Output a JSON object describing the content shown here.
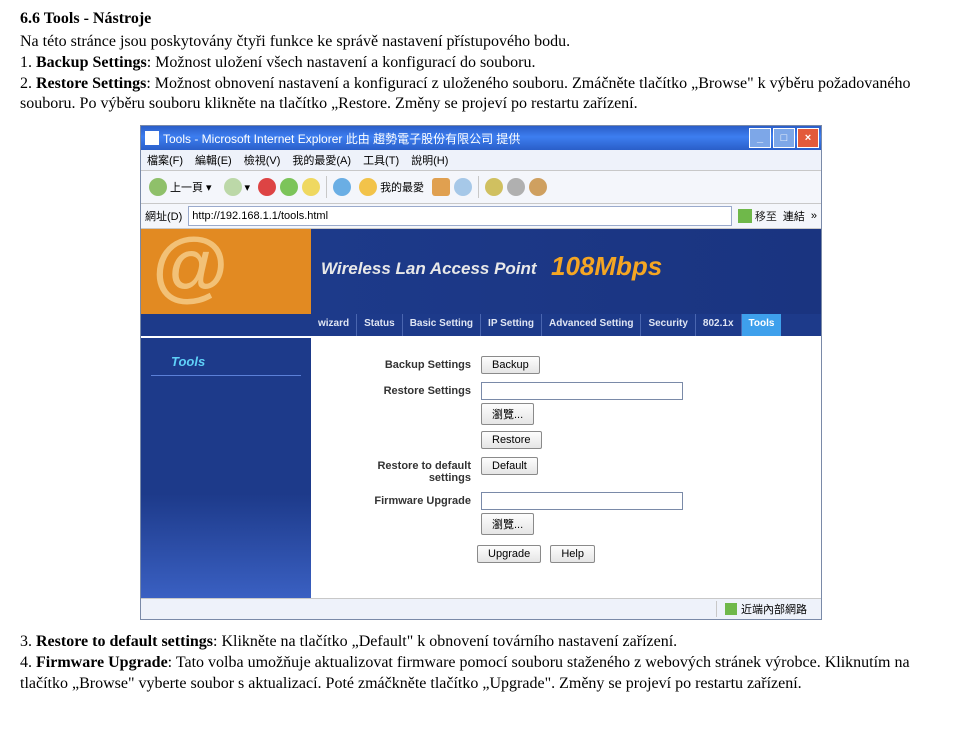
{
  "doc": {
    "heading": "6.6 Tools - Nástroje",
    "intro": "Na této stránce jsou poskytovány čtyři funkce ke správě nastavení přístupového bodu.",
    "p1a": "1. ",
    "p1b": "Backup Settings",
    "p1c": ": Možnost uložení všech nastavení a konfigurací do souboru.",
    "p2a": "2. ",
    "p2b": "Restore Settings",
    "p2c": ": Možnost obnovení nastavení a konfigurací z uloženého souboru. Zmáčněte tlačítko „Browse\" k výběru požadovaného souboru. Po výběru souboru klikněte na tlačítko „Restore. Změny se projeví po restartu zařízení.",
    "p3a": "3. ",
    "p3b": "Restore to default settings",
    "p3c": ": Klikněte na tlačítko „Default\" k obnovení továrního nastavení zařízení.",
    "p4a": "4. ",
    "p4b": "Firmware Upgrade",
    "p4c": ": Tato volba umožňuje aktualizovat firmware pomocí souboru staženého z webových stránek výrobce. Kliknutím na tlačítko „Browse\" vyberte soubor s aktualizací. Poté zmáčkněte tlačítko „Upgrade\". Změny se projeví po restartu zařízení."
  },
  "ie": {
    "title": "Tools - Microsoft Internet Explorer 此由 趨勢電子股份有限公司 提供",
    "menus": [
      "檔案(F)",
      "編輯(E)",
      "檢視(V)",
      "我的最愛(A)",
      "工具(T)",
      "說明(H)"
    ],
    "back": "上一頁",
    "favorites": "我的最愛",
    "addr_label": "網址(D)",
    "url": "http://192.168.1.1/tools.html",
    "go": "移至",
    "links": "連結",
    "status": "近端內部網路"
  },
  "page": {
    "brand": "Wireless Lan Access Point",
    "mbps": "108Mbps",
    "tabs": [
      "wizard",
      "Status",
      "Basic Setting",
      "IP Setting",
      "Advanced Setting",
      "Security",
      "802.1x",
      "Tools"
    ],
    "sidebar_item": "Tools",
    "labels": {
      "backup": "Backup Settings",
      "restore": "Restore Settings",
      "default": "Restore to default settings",
      "firmware": "Firmware Upgrade"
    },
    "buttons": {
      "backup": "Backup",
      "browse": "瀏覽...",
      "restore": "Restore",
      "default": "Default",
      "upgrade": "Upgrade",
      "help": "Help"
    }
  }
}
